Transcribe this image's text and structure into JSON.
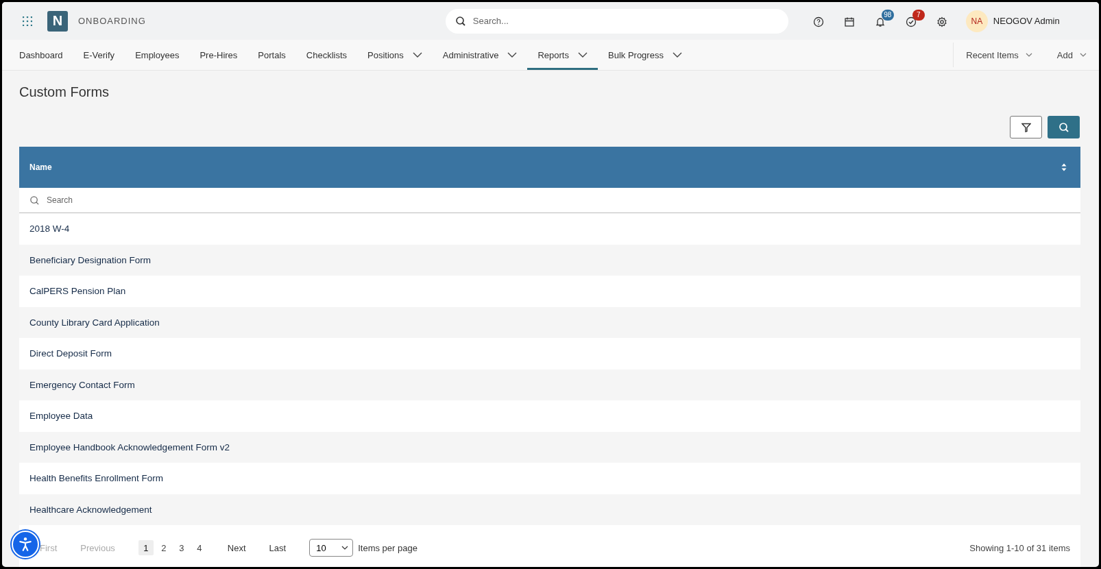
{
  "app": {
    "logo_letter": "N",
    "title": "ONBOARDING"
  },
  "global_search": {
    "placeholder": "Search..."
  },
  "top_icons": [
    {
      "kind": "help"
    },
    {
      "kind": "calendar"
    },
    {
      "kind": "bell",
      "badge": "98",
      "color": "#2f6e9e"
    },
    {
      "kind": "check",
      "badge": "7",
      "color": "#c0281b"
    },
    {
      "kind": "gear"
    }
  ],
  "user": {
    "initials": "NA",
    "name": "NEOGOV Admin"
  },
  "nav": [
    {
      "label": "Dashboard",
      "has_menu": false,
      "selected": false
    },
    {
      "label": "E-Verify",
      "has_menu": false,
      "selected": false
    },
    {
      "label": "Employees",
      "has_menu": false,
      "selected": false
    },
    {
      "label": "Pre-Hires",
      "has_menu": false,
      "selected": false
    },
    {
      "label": "Portals",
      "has_menu": false,
      "selected": false
    },
    {
      "label": "Checklists",
      "has_menu": false,
      "selected": false
    },
    {
      "label": "Positions",
      "has_menu": true,
      "selected": false
    },
    {
      "label": "Administrative",
      "has_menu": true,
      "selected": false
    },
    {
      "label": "Reports",
      "has_menu": true,
      "selected": true
    },
    {
      "label": "Bulk Progress",
      "has_menu": true,
      "selected": false
    }
  ],
  "nav_right": [
    "Recent Items",
    "Add"
  ],
  "page_title": "Custom Forms",
  "table": {
    "columns": [
      "Name"
    ],
    "search_placeholder": "Search",
    "rows": [
      "2018 W-4",
      "Beneficiary Designation Form",
      "CalPERS Pension Plan",
      "County Library Card Application",
      "Direct Deposit Form",
      "Emergency Contact Form",
      "Employee Data",
      "Employee Handbook Acknowledgement Form v2",
      "Health Benefits Enrollment Form",
      "Healthcare Acknowledgement"
    ]
  },
  "pagination": {
    "first": {
      "label": "First",
      "disabled": true
    },
    "previous": {
      "label": "Previous",
      "disabled": true
    },
    "pages": [
      {
        "label": "1",
        "selected": true
      },
      {
        "label": "2",
        "selected": false
      },
      {
        "label": "3",
        "selected": false
      },
      {
        "label": "4",
        "selected": false
      }
    ],
    "next": {
      "label": "Next",
      "disabled": false
    },
    "last": {
      "label": "Last",
      "disabled": false
    },
    "per_page": "10",
    "per_page_label": "Items per page",
    "summary": "Showing 1-10 of 31 items"
  }
}
